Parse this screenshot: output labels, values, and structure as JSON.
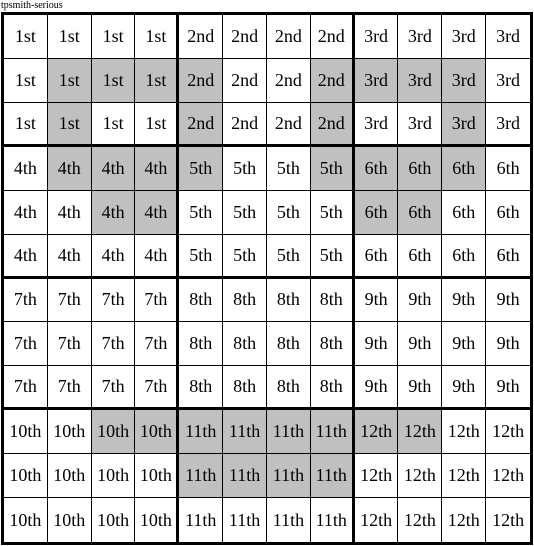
{
  "title": "tpsmith-serious",
  "grid": {
    "rows": 12,
    "cols": 12,
    "block_cols": 4,
    "block_rows": 3,
    "shade_color": "#c0c0c0",
    "cells": [
      [
        "1st",
        "1st",
        "1st",
        "1st",
        "2nd",
        "2nd",
        "2nd",
        "2nd",
        "3rd",
        "3rd",
        "3rd",
        "3rd"
      ],
      [
        "1st",
        "1st",
        "1st",
        "1st",
        "2nd",
        "2nd",
        "2nd",
        "2nd",
        "3rd",
        "3rd",
        "3rd",
        "3rd"
      ],
      [
        "1st",
        "1st",
        "1st",
        "1st",
        "2nd",
        "2nd",
        "2nd",
        "2nd",
        "3rd",
        "3rd",
        "3rd",
        "3rd"
      ],
      [
        "4th",
        "4th",
        "4th",
        "4th",
        "5th",
        "5th",
        "5th",
        "5th",
        "6th",
        "6th",
        "6th",
        "6th"
      ],
      [
        "4th",
        "4th",
        "4th",
        "4th",
        "5th",
        "5th",
        "5th",
        "5th",
        "6th",
        "6th",
        "6th",
        "6th"
      ],
      [
        "4th",
        "4th",
        "4th",
        "4th",
        "5th",
        "5th",
        "5th",
        "5th",
        "6th",
        "6th",
        "6th",
        "6th"
      ],
      [
        "7th",
        "7th",
        "7th",
        "7th",
        "8th",
        "8th",
        "8th",
        "8th",
        "9th",
        "9th",
        "9th",
        "9th"
      ],
      [
        "7th",
        "7th",
        "7th",
        "7th",
        "8th",
        "8th",
        "8th",
        "8th",
        "9th",
        "9th",
        "9th",
        "9th"
      ],
      [
        "7th",
        "7th",
        "7th",
        "7th",
        "8th",
        "8th",
        "8th",
        "8th",
        "9th",
        "9th",
        "9th",
        "9th"
      ],
      [
        "10th",
        "10th",
        "10th",
        "10th",
        "11th",
        "11th",
        "11th",
        "11th",
        "12th",
        "12th",
        "12th",
        "12th"
      ],
      [
        "10th",
        "10th",
        "10th",
        "10th",
        "11th",
        "11th",
        "11th",
        "11th",
        "12th",
        "12th",
        "12th",
        "12th"
      ],
      [
        "10th",
        "10th",
        "10th",
        "10th",
        "11th",
        "11th",
        "11th",
        "11th",
        "12th",
        "12th",
        "12th",
        "12th"
      ]
    ],
    "shaded": [
      [
        0,
        0,
        0,
        0,
        0,
        0,
        0,
        0,
        0,
        0,
        0,
        0
      ],
      [
        0,
        1,
        1,
        1,
        1,
        0,
        0,
        1,
        1,
        1,
        1,
        0
      ],
      [
        0,
        1,
        0,
        0,
        1,
        0,
        0,
        1,
        0,
        0,
        1,
        0
      ],
      [
        0,
        1,
        1,
        1,
        1,
        0,
        0,
        1,
        1,
        1,
        1,
        0
      ],
      [
        0,
        0,
        1,
        1,
        0,
        0,
        0,
        0,
        1,
        1,
        0,
        0
      ],
      [
        0,
        0,
        0,
        0,
        0,
        0,
        0,
        0,
        0,
        0,
        0,
        0
      ],
      [
        0,
        0,
        0,
        0,
        0,
        0,
        0,
        0,
        0,
        0,
        0,
        0
      ],
      [
        0,
        0,
        0,
        0,
        0,
        0,
        0,
        0,
        0,
        0,
        0,
        0
      ],
      [
        0,
        0,
        0,
        0,
        0,
        0,
        0,
        0,
        0,
        0,
        0,
        0
      ],
      [
        0,
        0,
        1,
        1,
        1,
        1,
        1,
        1,
        1,
        1,
        0,
        0
      ],
      [
        0,
        0,
        0,
        0,
        1,
        1,
        1,
        1,
        0,
        0,
        0,
        0
      ],
      [
        0,
        0,
        0,
        0,
        0,
        0,
        0,
        0,
        0,
        0,
        0,
        0
      ]
    ]
  }
}
